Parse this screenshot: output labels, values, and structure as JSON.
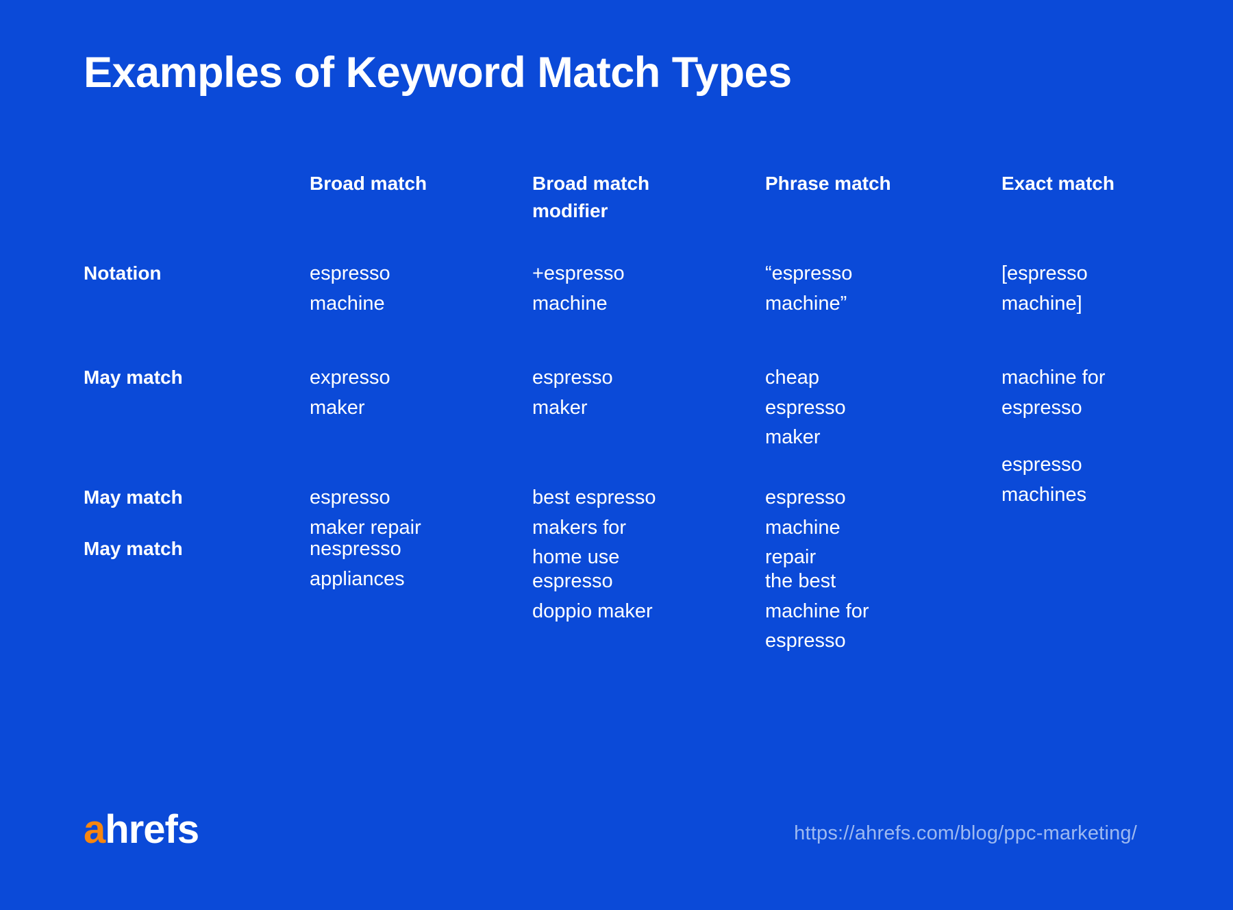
{
  "background_color": "#0B4AD8",
  "title": "Examples of Keyword Match Types",
  "table": {
    "corner_label": "",
    "columns": [
      {
        "header": "Broad match"
      },
      {
        "header": "Broad match\nmodifier"
      },
      {
        "header": "Phrase match"
      },
      {
        "header": "Exact match"
      }
    ],
    "rows": [
      {
        "label": "Notation",
        "cells": [
          "espresso\nmachine",
          "+espresso\nmachine",
          "“espresso\nmachine”",
          "[espresso\nmachine]"
        ]
      },
      {
        "label": "May match",
        "cells": [
          "expresso\nmaker",
          "espresso\nmaker",
          "cheap\nespresso\nmaker",
          "machine for\nespresso"
        ]
      },
      {
        "label": "May match",
        "cells": [
          "espresso\nmaker repair",
          "best espresso\nmakers for\nhome use",
          "espresso\nmachine\nrepair",
          "espresso\nmachines"
        ]
      },
      {
        "label": "May match",
        "cells": [
          "nespresso\nappliances",
          "espresso\ndoppio maker",
          "the best\nmachine for\nespresso",
          ""
        ]
      }
    ]
  },
  "footer": {
    "logo_accent": "a",
    "logo_rest": "hrefs",
    "logo_accent_color": "#F7860F",
    "source_url": "https://ahrefs.com/blog/ppc-marketing/",
    "source_url_color": "#9DB9F0"
  }
}
